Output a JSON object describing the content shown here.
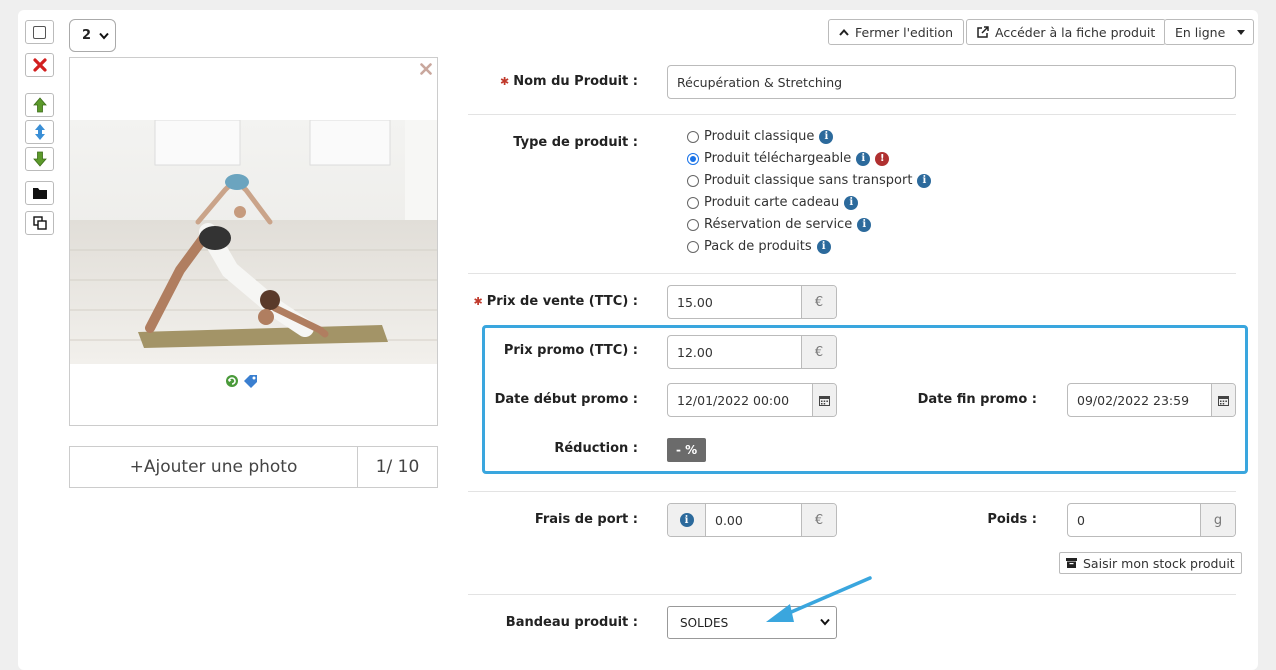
{
  "image_panel": {
    "position_select": "2",
    "add_photo_label": "+Ajouter une photo",
    "photo_count": "1/ 10"
  },
  "toolbar": {
    "close_edit_label": "Fermer l'edition",
    "product_page_label": "Accéder à la fiche produit",
    "status_label": "En ligne"
  },
  "form": {
    "name": {
      "label": "Nom du Produit :",
      "value": "Récupération & Stretching"
    },
    "type": {
      "label": "Type de produit :",
      "options": [
        "Produit classique",
        "Produit téléchargeable",
        "Produit classique sans transport",
        "Produit carte cadeau",
        "Réservation de service",
        "Pack de produits"
      ],
      "selected": "Produit téléchargeable"
    },
    "price": {
      "label": "Prix de vente (TTC) :",
      "value": "15.00",
      "currency": "€"
    },
    "promo_price": {
      "label": "Prix promo (TTC) :",
      "value": "12.00",
      "currency": "€"
    },
    "promo_start": {
      "label": "Date début promo :",
      "value": "12/01/2022 00:00"
    },
    "promo_end": {
      "label": "Date fin promo :",
      "value": "09/02/2022 23:59"
    },
    "reduction": {
      "label": "Réduction :",
      "value": "- %"
    },
    "shipping": {
      "label": "Frais de port :",
      "value": "0.00",
      "currency": "€"
    },
    "weight": {
      "label": "Poids :",
      "value": "0",
      "unit": "g"
    },
    "stock_button": "Saisir mon stock produit",
    "banner": {
      "label": "Bandeau produit :",
      "value": "SOLDES"
    }
  },
  "colors": {
    "promo_highlight": "#3aa6de",
    "required_star": "#c0392b",
    "info_icon": "#2c6a9c",
    "warning_icon": "#b03030",
    "annotation_arrow": "#3aa6de"
  }
}
